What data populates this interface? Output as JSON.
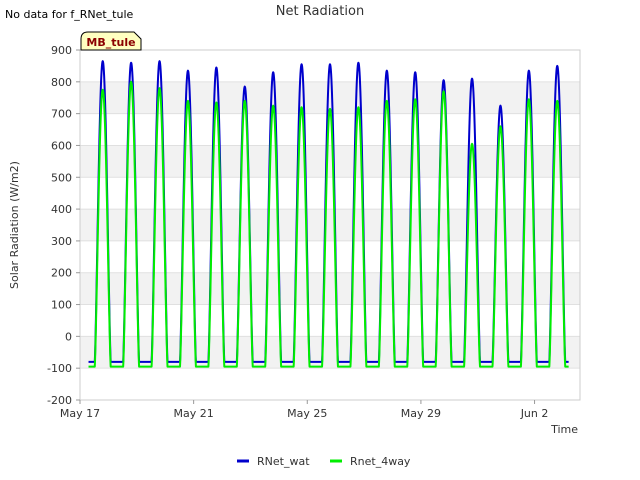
{
  "chart_data": {
    "type": "line",
    "title": "Net Radiation",
    "note": "No data for f_RNet_tule",
    "badge": "MB_tule",
    "xlabel": "Time",
    "ylabel": "Solar Radiation (W/m2)",
    "xlim": [
      0,
      17.6
    ],
    "ylim": [
      -200,
      900
    ],
    "yticks": [
      -200,
      -100,
      0,
      100,
      200,
      300,
      400,
      500,
      600,
      700,
      800,
      900
    ],
    "xticks": [
      {
        "value": 0,
        "label": "May 17"
      },
      {
        "value": 4,
        "label": "May 21"
      },
      {
        "value": 8,
        "label": "May 25"
      },
      {
        "value": 12,
        "label": "May 29"
      },
      {
        "value": 16,
        "label": "Jun 2"
      }
    ],
    "grid": true,
    "legend_position": "bottom",
    "x_start": 0.3,
    "x_end": 17.2,
    "series": [
      {
        "name": "RNet_wat",
        "color": "#0000cc",
        "night": -80,
        "days": [
          {
            "noon": 0.8,
            "peak": 865
          },
          {
            "noon": 1.8,
            "peak": 860
          },
          {
            "noon": 2.8,
            "peak": 865
          },
          {
            "noon": 3.8,
            "peak": 835
          },
          {
            "noon": 4.8,
            "peak": 845
          },
          {
            "noon": 5.8,
            "peak": 785
          },
          {
            "noon": 6.8,
            "peak": 830
          },
          {
            "noon": 7.8,
            "peak": 855
          },
          {
            "noon": 8.8,
            "peak": 855
          },
          {
            "noon": 9.8,
            "peak": 860
          },
          {
            "noon": 10.8,
            "peak": 835
          },
          {
            "noon": 11.8,
            "peak": 830
          },
          {
            "noon": 12.8,
            "peak": 805
          },
          {
            "noon": 13.8,
            "peak": 810
          },
          {
            "noon": 14.8,
            "peak": 725
          },
          {
            "noon": 15.8,
            "peak": 835
          },
          {
            "noon": 16.8,
            "peak": 850
          }
        ]
      },
      {
        "name": "Rnet_4way",
        "color": "#00ee00",
        "night": -95,
        "days": [
          {
            "noon": 0.8,
            "peak": 775
          },
          {
            "noon": 1.8,
            "peak": 800
          },
          {
            "noon": 2.8,
            "peak": 780
          },
          {
            "noon": 3.8,
            "peak": 740
          },
          {
            "noon": 4.8,
            "peak": 735
          },
          {
            "noon": 5.8,
            "peak": 740
          },
          {
            "noon": 6.8,
            "peak": 725
          },
          {
            "noon": 7.8,
            "peak": 720
          },
          {
            "noon": 8.8,
            "peak": 715
          },
          {
            "noon": 9.8,
            "peak": 720
          },
          {
            "noon": 10.8,
            "peak": 740
          },
          {
            "noon": 11.8,
            "peak": 745
          },
          {
            "noon": 12.8,
            "peak": 770
          },
          {
            "noon": 13.8,
            "peak": 605
          },
          {
            "noon": 14.8,
            "peak": 660
          },
          {
            "noon": 15.8,
            "peak": 745
          },
          {
            "noon": 16.8,
            "peak": 740
          }
        ]
      }
    ]
  }
}
